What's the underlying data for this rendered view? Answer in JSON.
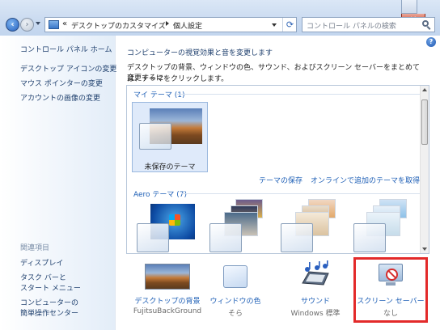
{
  "window": {
    "close_label": "✕"
  },
  "address_bar": {
    "chevron": "«",
    "crumbs": [
      "デスクトップのカスタマイズ",
      "個人設定"
    ]
  },
  "search": {
    "placeholder": "コントロール パネルの検索"
  },
  "help": {
    "label": "?"
  },
  "left_pane": {
    "home": "コントロール パネル ホーム",
    "links": [
      "デスクトップ アイコンの変更",
      "マウス ポインターの変更",
      "アカウントの画像の変更"
    ],
    "related_heading": "関連項目",
    "related_links": [
      "ディスプレイ",
      "タスク バーと",
      "スタート メニュー",
      "コンピューターの",
      "簡単操作センター"
    ]
  },
  "main": {
    "title": "コンピューターの視覚効果と音を変更します",
    "description_line1": "デスクトップの背景、ウィンドウの色、サウンド、およびスクリーン セーバーをまとめて変更するに",
    "description_line2": "は、テーマをクリックします。"
  },
  "themes": {
    "my_themes_header": "マイ テーマ (1)",
    "unsaved_label": "未保存のテーマ",
    "save_theme_link": "テーマの保存",
    "get_more_link": "オンラインで追加のテーマを取得",
    "aero_header": "Aero テーマ (7)"
  },
  "bottom_bar": {
    "items": [
      {
        "label": "デスクトップの背景",
        "sub": "FujitsuBackGround",
        "icon": "wallpaper-icon"
      },
      {
        "label": "ウィンドウの色",
        "sub": "そら",
        "icon": "window-color-icon"
      },
      {
        "label": "サウンド",
        "sub": "Windows 標準",
        "icon": "sound-icon"
      },
      {
        "label": "スクリーン セーバー",
        "sub": "なし",
        "icon": "screensaver-icon"
      }
    ]
  },
  "colors": {
    "link": "#1e5fb6",
    "highlight": "#e32a2a"
  }
}
